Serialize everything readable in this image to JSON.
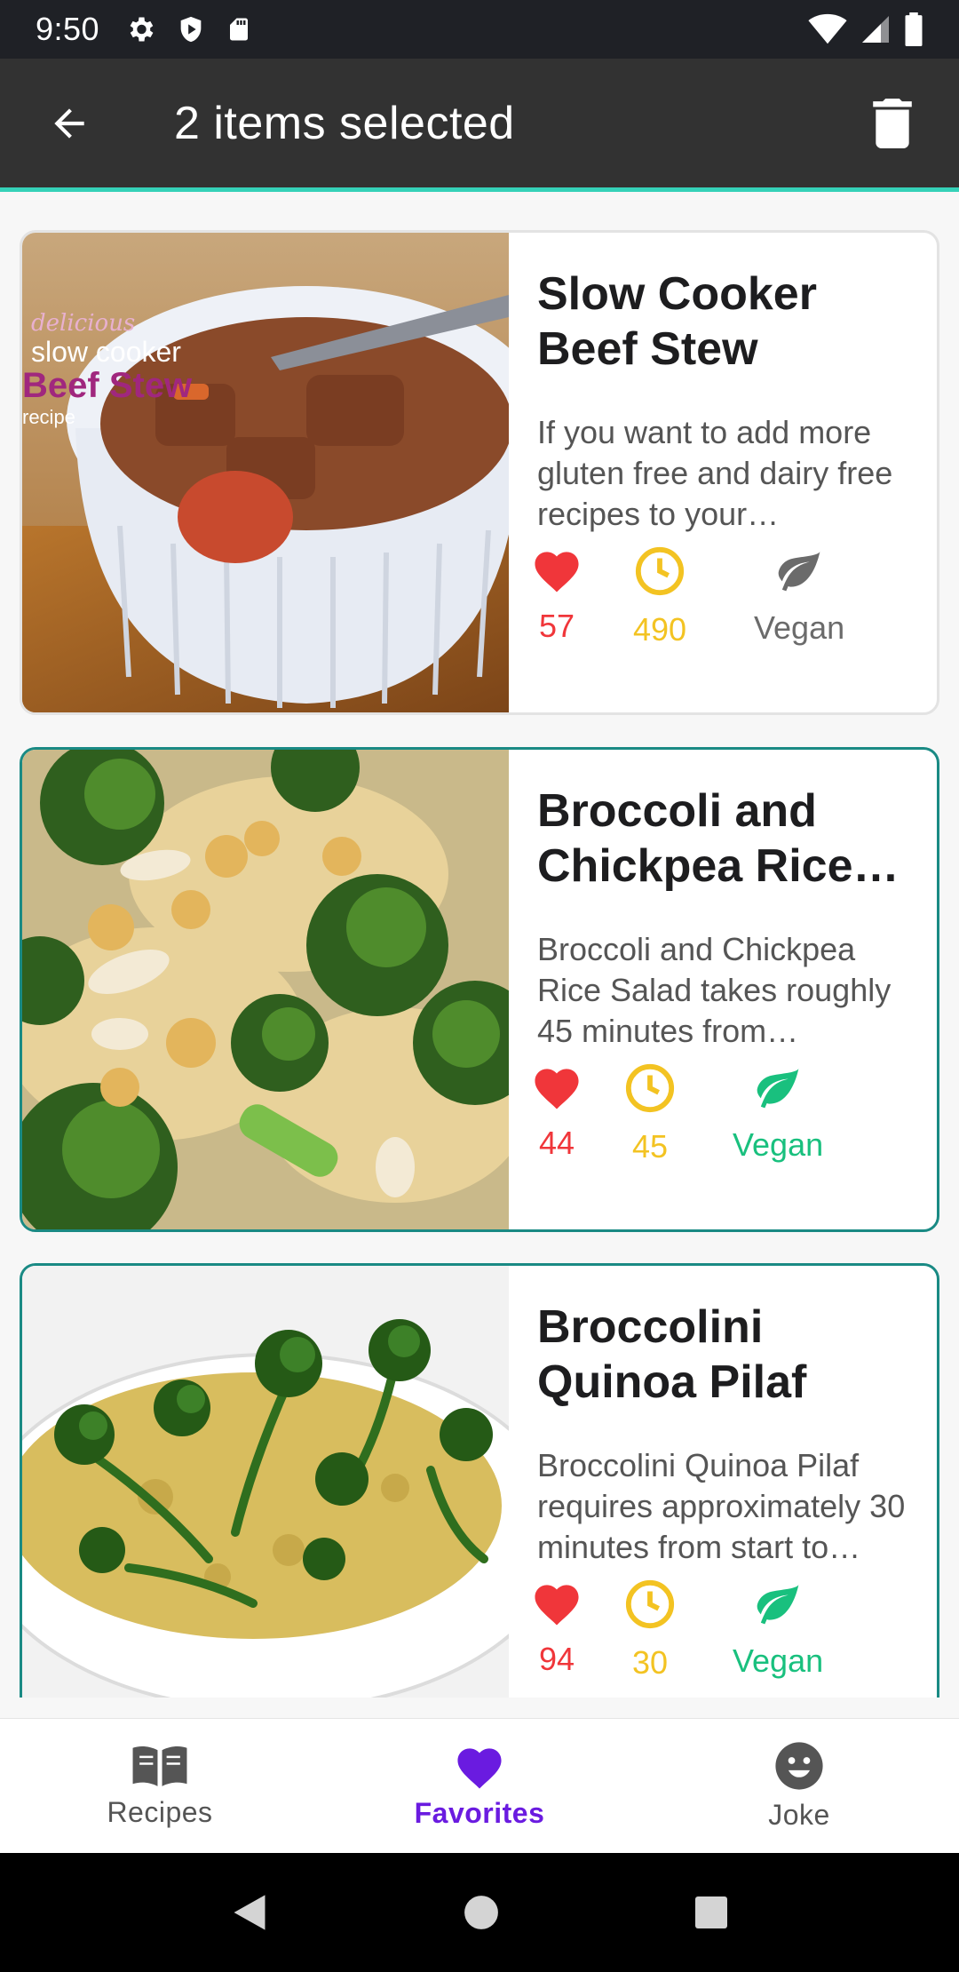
{
  "status_bar": {
    "time": "9:50"
  },
  "app_bar": {
    "title": "2 items selected"
  },
  "cards": [
    {
      "title": "Slow Cooker Beef Stew",
      "description": "If you want to add more gluten free and dairy free recipes to your repertoire…",
      "likes": "57",
      "minutes": "490",
      "vegan_label": "Vegan",
      "selected": false,
      "vegan": false,
      "image_text": "delicious slow cooker Beef Stew recipe"
    },
    {
      "title": "Broccoli and Chickpea Rice Salad",
      "description": "Broccoli and Chickpea Rice Salad takes roughly 45 minutes from beginning to end.",
      "likes": "44",
      "minutes": "45",
      "vegan_label": "Vegan",
      "selected": true,
      "vegan": true
    },
    {
      "title": "Broccolini Quinoa Pilaf",
      "description": "Broccolini Quinoa Pilaf requires approximately 30 minutes from start to finish.",
      "likes": "94",
      "minutes": "30",
      "vegan_label": "Vegan",
      "selected": true,
      "vegan": true
    }
  ],
  "bottom_nav": {
    "items": [
      {
        "label": "Recipes",
        "icon": "book-icon",
        "active": false
      },
      {
        "label": "Favorites",
        "icon": "heart-icon",
        "active": true
      },
      {
        "label": "Joke",
        "icon": "smiley-icon",
        "active": false
      }
    ]
  },
  "colors": {
    "app_bar": "#323232",
    "accent": "#35d1b8",
    "selected_border": "#1a8a84",
    "heart": "#f0363a",
    "clock": "#f3c322",
    "vegan_green": "#19c07e",
    "vegan_grey": "#6b6b6b",
    "nav_active": "#6a1be0"
  }
}
